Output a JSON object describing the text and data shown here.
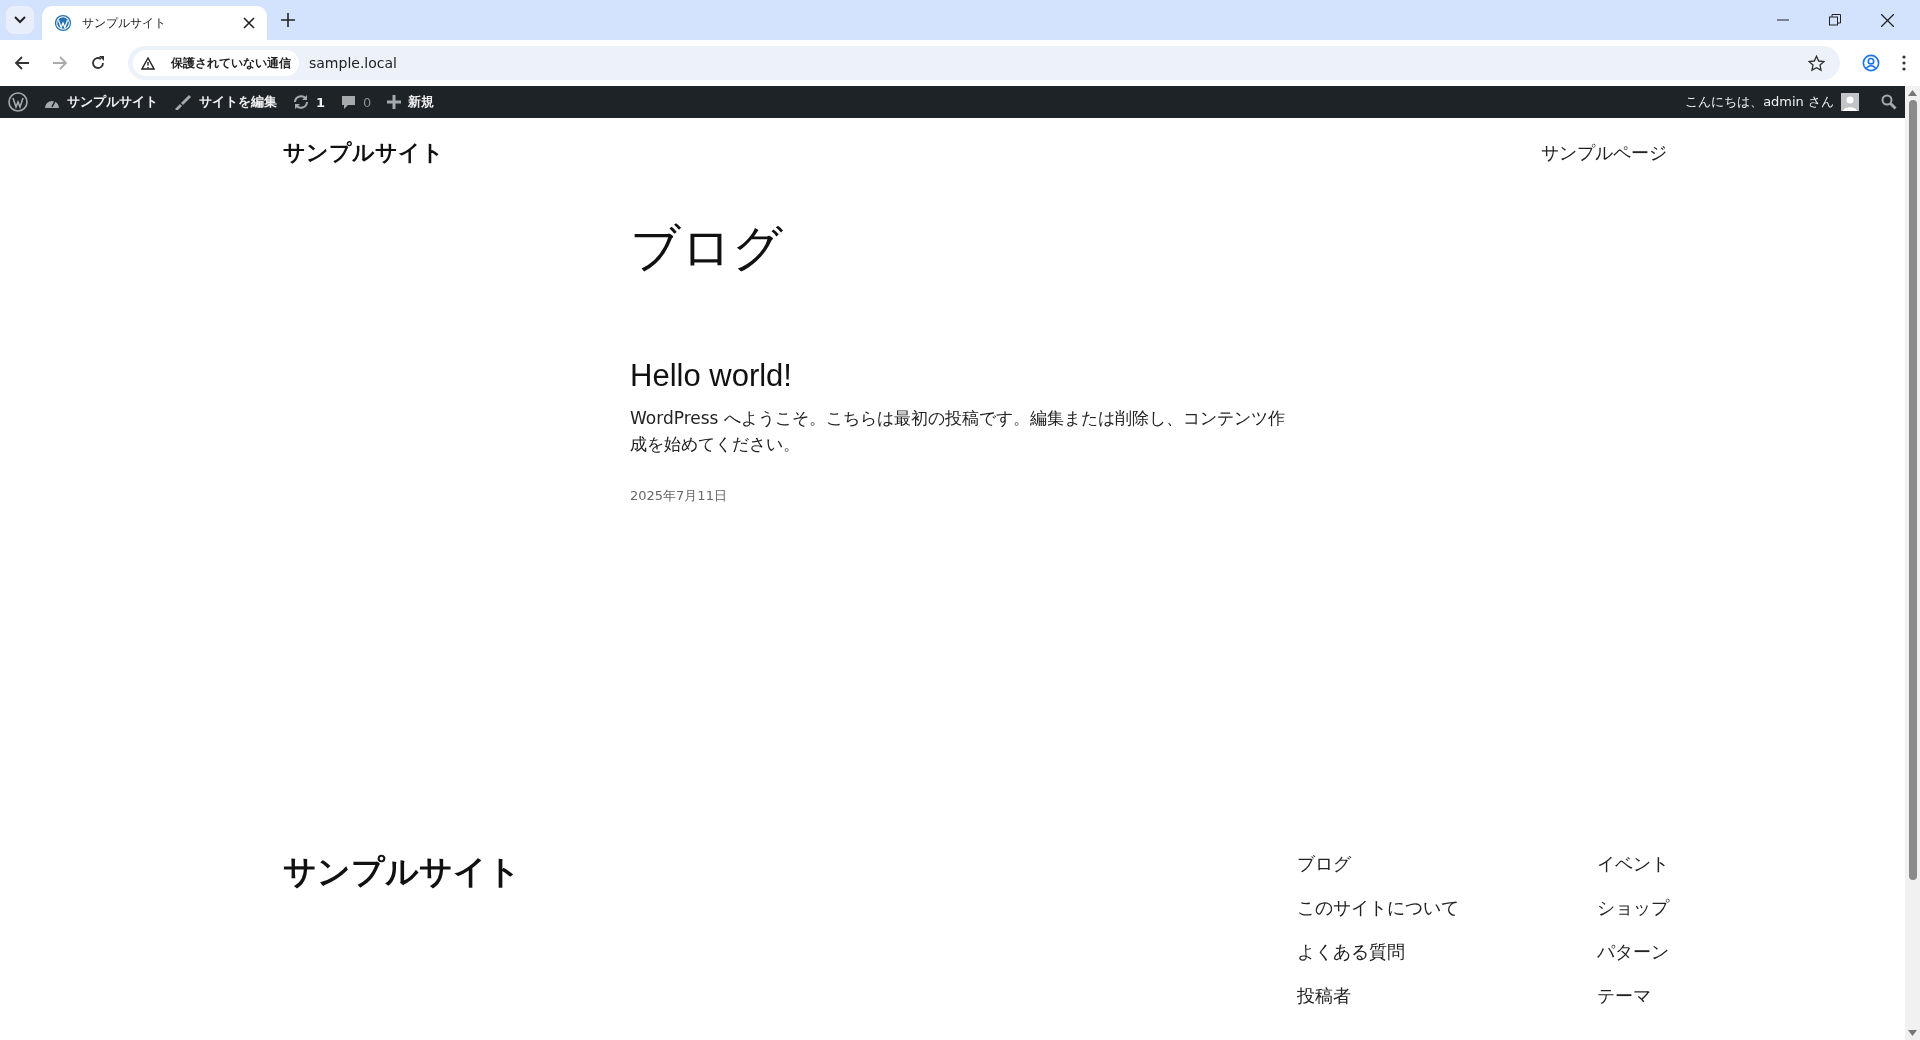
{
  "browser": {
    "tabs": [
      {
        "title": "サンプルサイト",
        "selected": true
      }
    ],
    "security_label": "保護されていない通信",
    "url": "sample.local"
  },
  "admin_bar": {
    "items": [
      {
        "kind": "dashboard",
        "label": "サンプルサイト"
      },
      {
        "kind": "edit",
        "label": "サイトを編集"
      },
      {
        "kind": "updates",
        "label": "1"
      },
      {
        "kind": "comments",
        "label": "0"
      },
      {
        "kind": "new",
        "label": "新規"
      }
    ],
    "greeting": "こんにちは、admin さん"
  },
  "header": {
    "site_title": "サンプルサイト",
    "nav": [
      "サンプルページ"
    ]
  },
  "page_title": "ブログ",
  "posts": [
    {
      "title": "Hello world!",
      "excerpt": "WordPress へようこそ。こちらは最初の投稿です。編集または削除し、コンテンツ作成を始めてください。",
      "date": "2025年7月11日"
    }
  ],
  "footer": {
    "site_title": "サンプルサイト",
    "columns": [
      [
        "ブログ",
        "このサイトについて",
        "よくある質問",
        "投稿者"
      ],
      [
        "イベント",
        "ショップ",
        "パターン",
        "テーマ"
      ]
    ]
  }
}
